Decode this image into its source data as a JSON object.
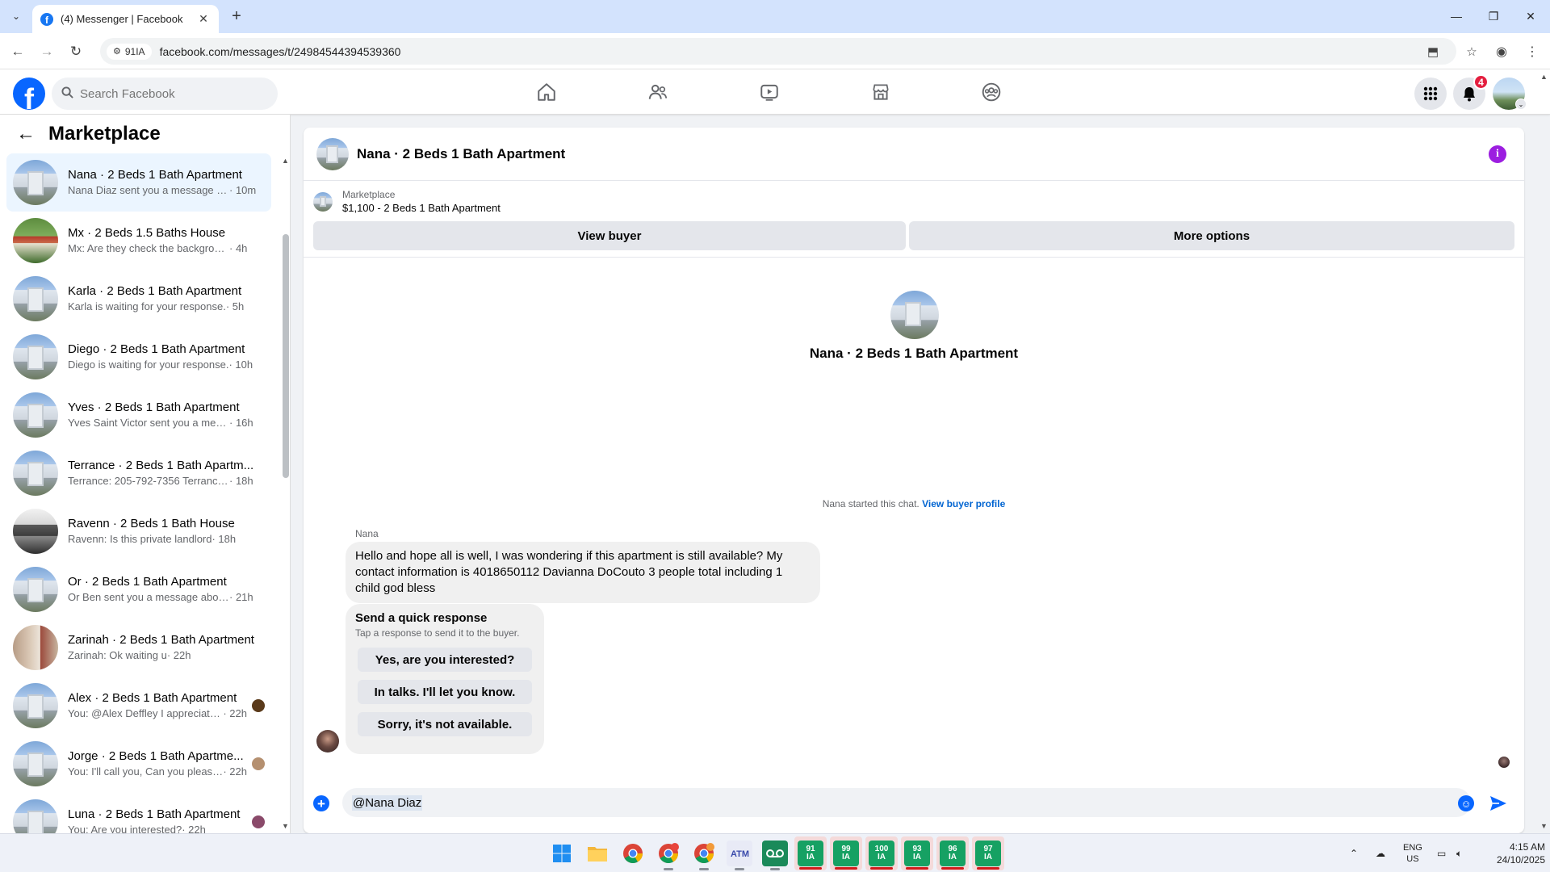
{
  "browser": {
    "tab_title": "(4) Messenger | Facebook",
    "site_chip": "91IA",
    "url": "facebook.com/messages/t/24984544394539360"
  },
  "fb": {
    "search_placeholder": "Search Facebook",
    "notification_count": "4"
  },
  "sidebar": {
    "title": "Marketplace",
    "conversations": [
      {
        "name": "Nana · 2 Beds 1 Bath Apartment",
        "preview": "Nana Diaz sent you a message ab...",
        "time": "· 10m",
        "avatar": "apt",
        "active": true
      },
      {
        "name": "Mx · 2 Beds 1.5 Baths House",
        "preview": "Mx: Are they check the background?",
        "time": "· 4h",
        "avatar": "house-green"
      },
      {
        "name": "Karla · 2 Beds 1 Bath Apartment",
        "preview": "Karla is waiting for your response.",
        "time": "· 5h",
        "avatar": "apt"
      },
      {
        "name": "Diego · 2 Beds 1 Bath Apartment",
        "preview": "Diego is waiting for your response.",
        "time": "· 10h",
        "avatar": "apt"
      },
      {
        "name": "Yves · 2 Beds 1 Bath Apartment",
        "preview": "Yves Saint Victor sent you a mess...",
        "time": "· 16h",
        "avatar": "apt"
      },
      {
        "name": "Terrance · 2 Beds 1 Bath Apartm...",
        "preview": "Terrance: 205-792-7356 Terrance ...",
        "time": "· 18h",
        "avatar": "apt"
      },
      {
        "name": "Ravenn · 2 Beds 1 Bath House",
        "preview": "Ravenn: Is this private landlord",
        "time": "· 18h",
        "avatar": "house-bw"
      },
      {
        "name": "Or · 2 Beds 1 Bath Apartment",
        "preview": "Or Ben sent you a message about ...",
        "time": "· 21h",
        "avatar": "apt"
      },
      {
        "name": "Zarinah · 2 Beds 1 Bath Apartment",
        "preview": "Zarinah: Ok waiting u",
        "time": "· 22h",
        "avatar": "interior"
      },
      {
        "name": "Alex · 2 Beds 1 Bath Apartment",
        "preview": "You: @Alex Deffley I appreciate...",
        "time": "· 22h",
        "avatar": "apt",
        "read": "#5a3a1a"
      },
      {
        "name": "Jorge · 2 Beds 1 Bath Apartme...",
        "preview": "You: I'll call you, Can you please...",
        "time": "· 22h",
        "avatar": "apt",
        "read": "#b59070"
      },
      {
        "name": "Luna · 2 Beds 1 Bath Apartment",
        "preview": "You: Are you interested?",
        "time": "· 22h",
        "avatar": "apt",
        "read": "#8a4a6a"
      }
    ]
  },
  "chat": {
    "title": "Nana · 2 Beds 1 Bath Apartment",
    "listing_label": "Marketplace",
    "listing_price": "$1,100 - 2 Beds 1 Bath Apartment",
    "view_buyer": "View buyer",
    "more_options": "More options",
    "intro_title": "Nana · 2 Beds 1 Bath Apartment",
    "started_text": "Nana started this chat.",
    "view_buyer_profile": "View buyer profile",
    "sender_name": "Nana",
    "message": "Hello and hope all is well, I was wondering if this apartment is still available? My contact information is 4018650112 Davianna DoCouto 3 people total including 1 child god bless",
    "quick_title": "Send a quick response",
    "quick_subtitle": "Tap a response to send it to the buyer.",
    "quick_responses": [
      "Yes, are you interested?",
      "In talks. I'll let you know.",
      "Sorry, it's not available."
    ],
    "composer_value": "@Nana Diaz"
  },
  "taskbar": {
    "sheets": [
      "91\nIA",
      "99\nIA",
      "100\nIA",
      "93\nIA",
      "96\nIA",
      "97\nIA"
    ],
    "lang_line1": "ENG",
    "lang_line2": "US",
    "time": "4:15 AM",
    "date": "24/10/2025"
  },
  "colors": {
    "fb_blue": "#0866ff",
    "active_conv_bg": "#ebf5ff",
    "info_purple": "#9c1ee0",
    "badge_red": "#e41e3f"
  }
}
